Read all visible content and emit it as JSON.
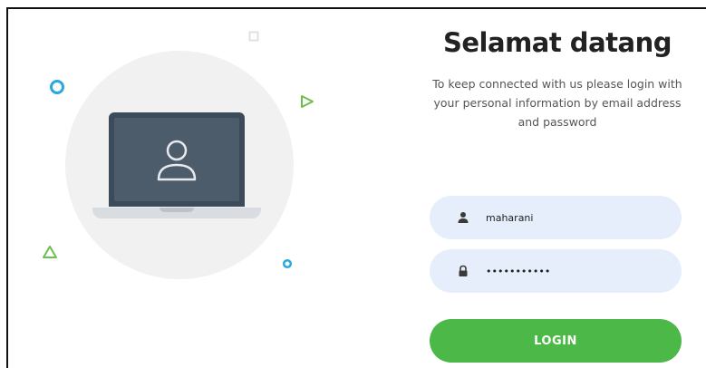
{
  "login": {
    "title": "Selamat datang",
    "subtitle": "To keep connected with us please login with your personal information by email address and password",
    "username": {
      "value": "maharani",
      "icon": "user-icon"
    },
    "password": {
      "value": "•••••••••••",
      "icon": "lock-icon"
    },
    "button_label": "LOGIN"
  },
  "illustration": {
    "laptop_icon": "laptop-icon",
    "user_icon": "user-outline-icon"
  },
  "colors": {
    "accent_green": "#4cb848",
    "input_bg": "#e6eefb",
    "deco_blue": "#29a8e0",
    "deco_green": "#6bc04b",
    "laptop_dark": "#3c4b5a"
  }
}
